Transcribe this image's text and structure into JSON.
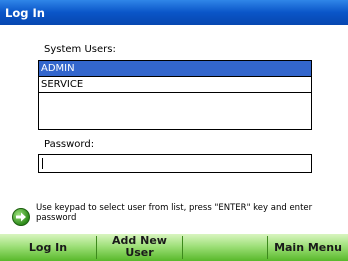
{
  "window": {
    "title": "Log In"
  },
  "users": {
    "label": "System Users:",
    "items": [
      "ADMIN",
      "SERVICE"
    ],
    "selected": "ADMIN"
  },
  "password": {
    "label": "Password:",
    "value": ""
  },
  "help": {
    "icon": "green-arrow-icon",
    "text": "Use keypad to select user from list, press \"ENTER\" key and enter password"
  },
  "toolbar": {
    "login_label": "Log In",
    "add_user_label": "Add New User",
    "blank_label": "",
    "main_menu_label": "Main Menu"
  },
  "colors": {
    "title_bar": "#0a55c8",
    "selection": "#3366cc",
    "toolbar_green": "#9fe07a"
  }
}
